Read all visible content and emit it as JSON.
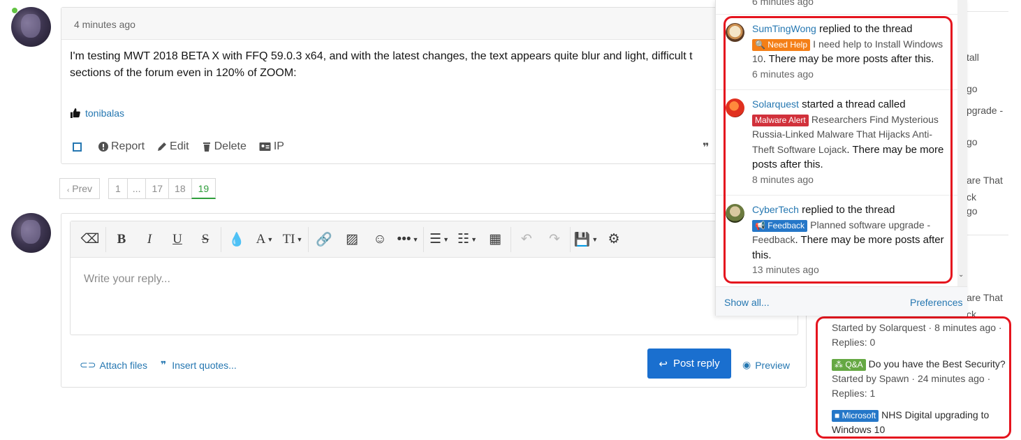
{
  "post": {
    "time": "4 minutes ago",
    "body_line1": "I'm testing MWT 2018 BETA X with FFQ 59.0.3 x64, and with the latest changes, the text appears quite blur and light, difficult t",
    "body_line2": "sections of the forum even in 120% of ZOOM:",
    "like_user": "tonibalas",
    "actions": {
      "report": "Report",
      "edit": "Edit",
      "delete": "Delete",
      "ip": "IP"
    }
  },
  "pagination": {
    "prev": "Prev",
    "pages": [
      "1",
      "...",
      "17",
      "18",
      "19"
    ],
    "current": "19"
  },
  "editor": {
    "placeholder": "Write your reply...",
    "attach": "Attach files",
    "insert_quotes": "Insert quotes...",
    "post_reply": "Post reply",
    "preview": "Preview"
  },
  "alerts": {
    "top_cut": "6 minutes ago",
    "items": [
      {
        "user": "SumTingWong",
        "action": "replied to the thread",
        "label": "Need Help",
        "label_color": "#f47f17",
        "title": "I need help to Install Windows 10",
        "suffix": ". There may be more posts after this.",
        "time": "6 minutes ago"
      },
      {
        "user": "Solarquest",
        "action": "started a thread called",
        "label": "Malware Alert",
        "label_color": "#d1313b",
        "title": "Researchers Find Mysterious Russia-Linked Malware That Hijacks Anti-Theft Software Lojack",
        "suffix": ". There may be more posts after this.",
        "time": "8 minutes ago"
      },
      {
        "user": "CyberTech",
        "action": "replied to the thread",
        "label": "Feedback",
        "label_color": "#2577c8",
        "title": "Planned software upgrade - Feedback",
        "suffix": ". There may be more posts after this.",
        "time": "13 minutes ago"
      }
    ],
    "show_all": "Show all...",
    "preferences": "Preferences"
  },
  "sidebar": {
    "fragments": [
      "tall",
      "go",
      "pgrade -",
      "go",
      "are That",
      "ck",
      "go",
      "are That",
      "ck"
    ],
    "items": [
      {
        "meta": "Started by Solarquest · 8 minutes ago ·",
        "replies": "Replies: 0"
      },
      {
        "label": "Q&A",
        "label_color": "#65a843",
        "title": "Do you have the Best Security?",
        "meta": "Started by Spawn · 24 minutes ago ·",
        "replies": "Replies: 1"
      },
      {
        "label": "Microsoft",
        "label_color": "#2577c8",
        "title": "NHS Digital upgrading to",
        "title2": "Windows 10"
      }
    ]
  }
}
